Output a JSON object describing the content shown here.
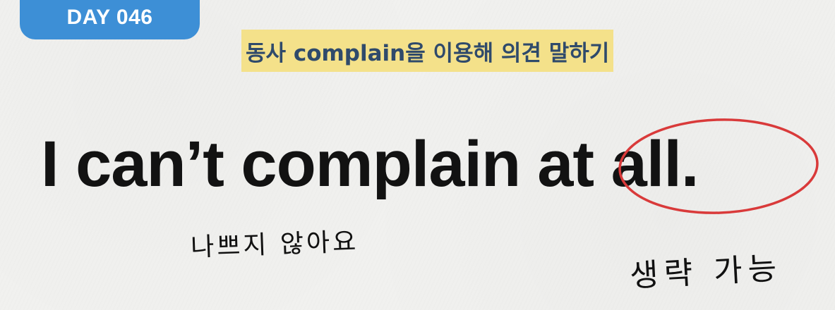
{
  "header": {
    "day_badge": "DAY 046",
    "subtitle": "동사 complain을 이용해 의견 말하기"
  },
  "main": {
    "sentence_part1": "I can’t complain",
    "sentence_highlight": "at all",
    "sentence_end": "."
  },
  "notes": {
    "meaning": "나쁘지 않아요",
    "omittable": "생략 가능"
  },
  "colors": {
    "badge_blue": "#3d8fd6",
    "highlight_yellow": "#f4e18a",
    "circle_red": "#d93a3a",
    "subtitle_text": "#2f4a6b"
  }
}
